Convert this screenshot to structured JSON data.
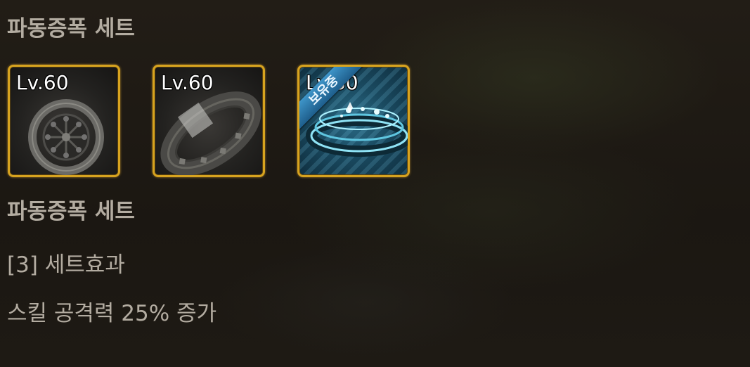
{
  "set": {
    "title": "파동증폭 세트",
    "items": [
      {
        "level": "Lv.60",
        "icon": "ring-icon",
        "owned": false
      },
      {
        "level": "Lv.60",
        "icon": "bracelet-icon",
        "owned": false
      },
      {
        "level": "Lv.60",
        "icon": "bracelet-icon",
        "owned": true,
        "owned_badge": "보유중"
      }
    ],
    "detail": {
      "title": "파동증폭 세트",
      "effect_label": "[3] 세트효과",
      "effect_description": "스킬 공격력 25% 증가"
    }
  },
  "colors": {
    "frame": "#d7a31f",
    "text": "#b3aca1",
    "owned_ribbon": "#2f7fb4"
  }
}
